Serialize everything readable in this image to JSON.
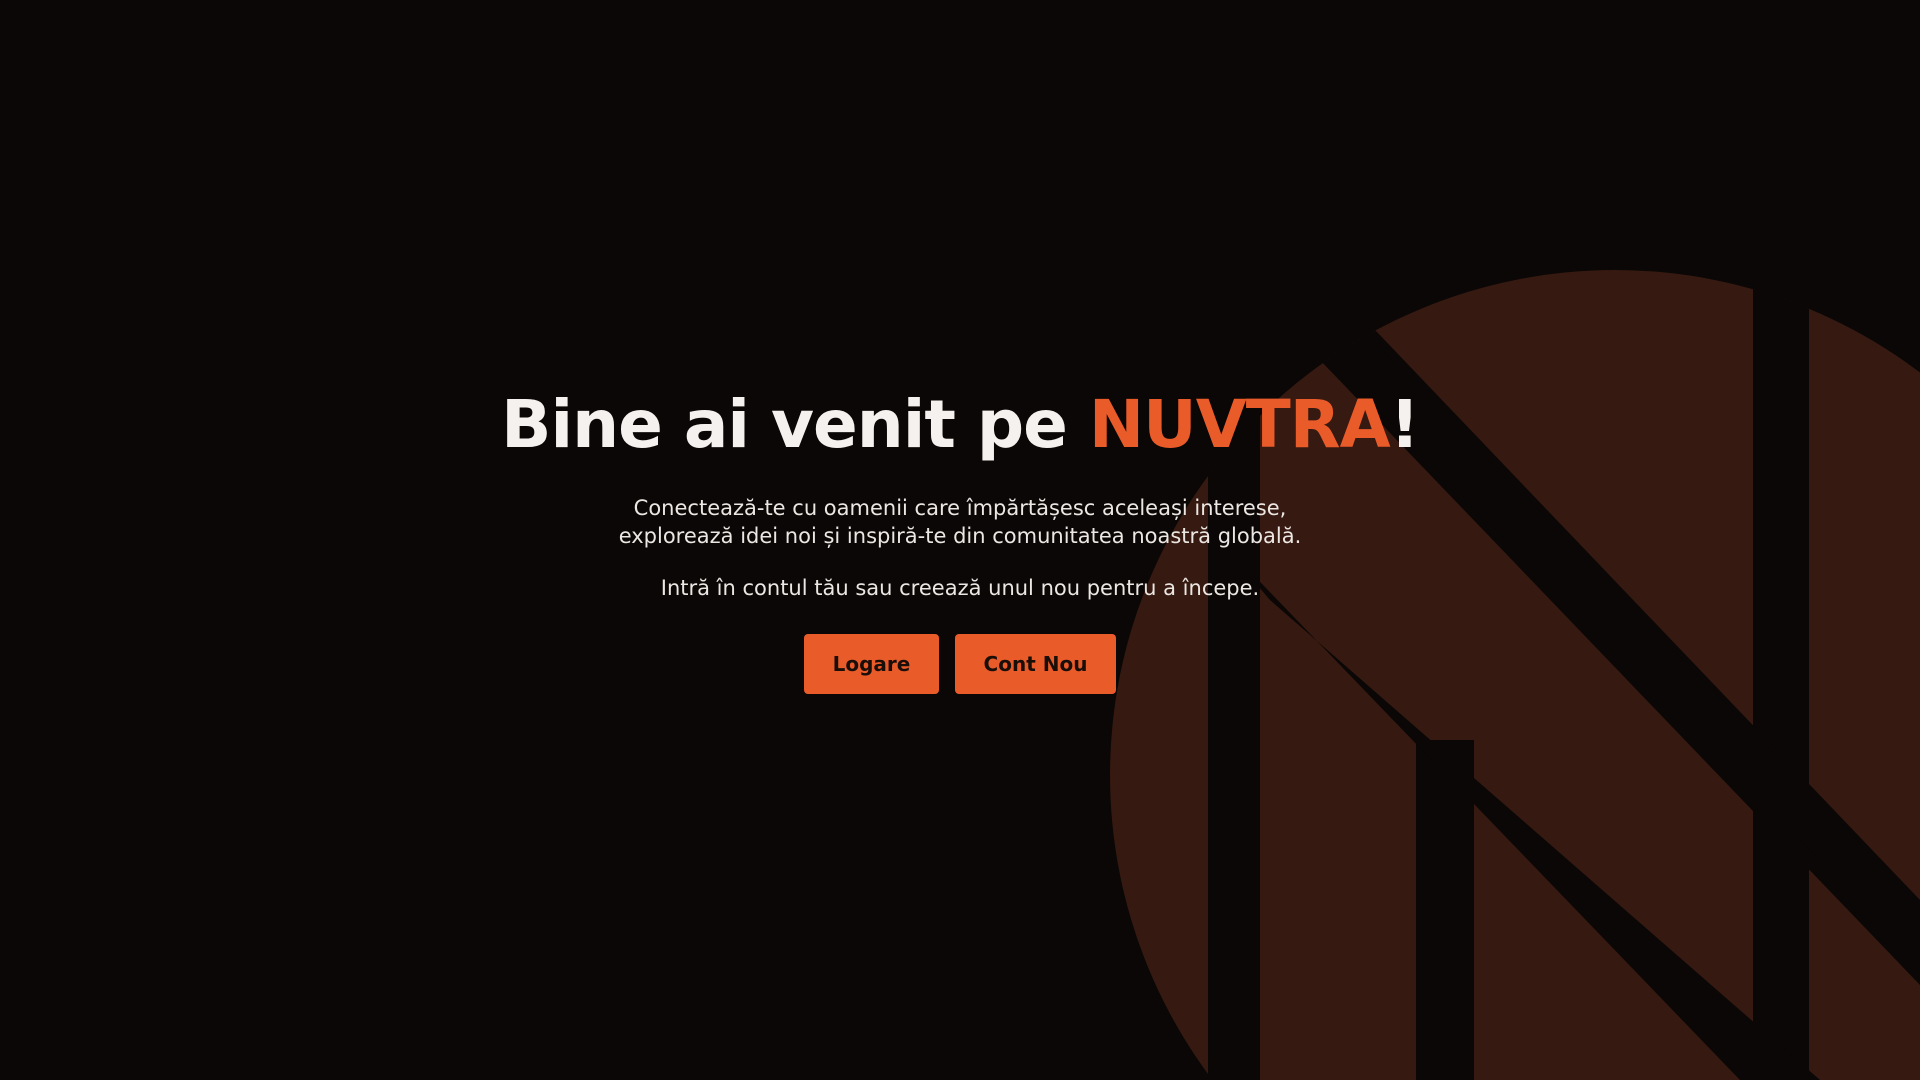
{
  "hero": {
    "title_prefix": "Bine ai venit pe ",
    "brand_name": "NUVTRA",
    "title_suffix": "!",
    "subtitle": "Conectează-te cu oamenii care împărtășesc aceleași interese, explorează idei noi și inspiră-te din comunitatea noastră globală.",
    "prompt": "Intră în contul tău sau creează unul nou pentru a începe."
  },
  "actions": {
    "login_label": "Logare",
    "register_label": "Cont Nou"
  },
  "colors": {
    "background": "#0a0706",
    "accent": "#ea5b2a",
    "logo_watermark": "#361910",
    "text": "#f4f1ee"
  },
  "icons": {
    "background_logo": "nuvtra-logo-icon"
  }
}
